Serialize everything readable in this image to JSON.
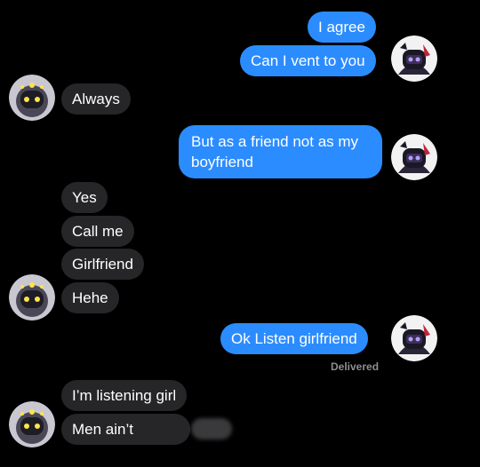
{
  "messages": [
    {
      "id": "m1",
      "dir": "sent",
      "text": "I agree"
    },
    {
      "id": "m2",
      "dir": "sent",
      "text": "Can I vent to you"
    },
    {
      "id": "m3",
      "dir": "received",
      "text": "Always"
    },
    {
      "id": "m4",
      "dir": "sent",
      "text": "But as a friend not as my boyfriend"
    },
    {
      "id": "m5",
      "dir": "received",
      "text": "Yes"
    },
    {
      "id": "m6",
      "dir": "received",
      "text": "Call me"
    },
    {
      "id": "m7",
      "dir": "received",
      "text": "Girlfriend"
    },
    {
      "id": "m8",
      "dir": "received",
      "text": "Hehe"
    },
    {
      "id": "m9",
      "dir": "sent",
      "text": "Ok Listen girlfriend"
    },
    {
      "id": "m10",
      "dir": "received",
      "text": "I’m listening girl"
    },
    {
      "id": "m11",
      "dir": "received",
      "text": "Men ain’t"
    }
  ],
  "status": {
    "delivered": "Delivered"
  },
  "avatars": {
    "sender": "dark-robot-avatar-icon",
    "receiver": "yellow-eyed-robot-avatar-icon"
  },
  "colors": {
    "background": "#000000",
    "sent_bubble": "#2b8cff",
    "received_bubble": "#262628",
    "status_text": "#8e8e93"
  }
}
